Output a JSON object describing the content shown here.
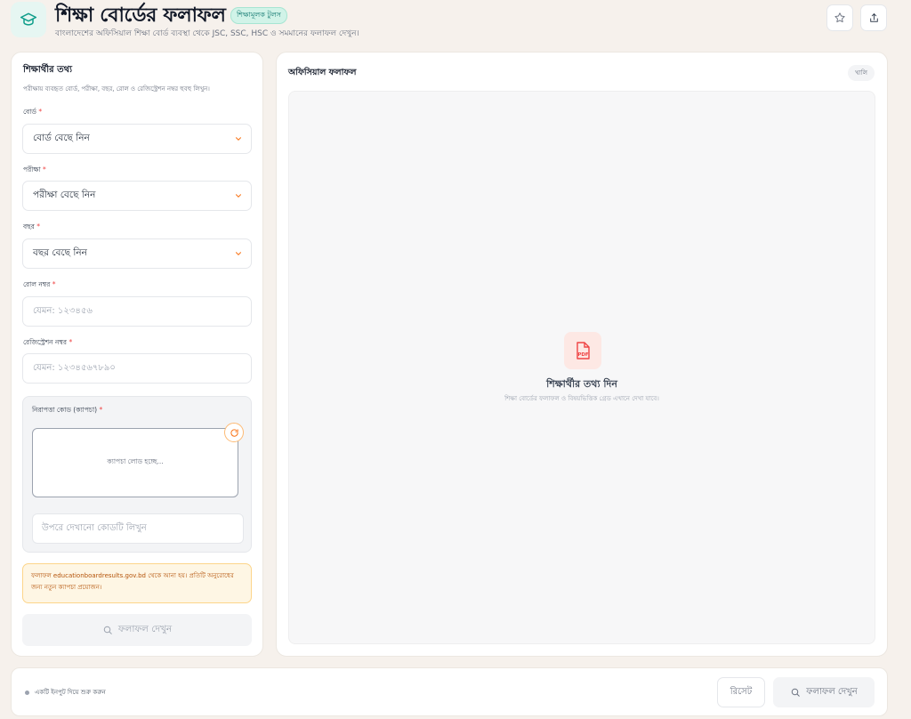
{
  "header": {
    "title": "শিক্ষা বোর্ডের ফলাফল",
    "badge": "শিক্ষামূলক টুলস",
    "subtitle": "বাংলাদেশের অফিসিয়াল শিক্ষা বোর্ড ব্যবস্থা থেকে JSC, SSC, HSC ও সমমানের ফলাফল দেখুন।",
    "logo_icon": "graduation-cap-icon",
    "favorite_icon": "star-icon",
    "share_icon": "share-icon"
  },
  "form": {
    "section_title": "শিক্ষার্থীর তথ্য",
    "section_desc": "পরীক্ষায় ব্যবহৃত বোর্ড, পরীক্ষা, বছর, রোল ও রেজিস্ট্রেশন নম্বর হুবহু লিখুন।",
    "required_mark": "*",
    "board": {
      "label": "বোর্ড",
      "value": "বোর্ড বেছে নিন"
    },
    "exam": {
      "label": "পরীক্ষা",
      "value": "পরীক্ষা বেছে নিন"
    },
    "year": {
      "label": "বছর",
      "value": "বছর বেছে নিন"
    },
    "roll": {
      "label": "রোল নম্বর",
      "placeholder": "যেমন: ১২৩৪৫৬"
    },
    "registration": {
      "label": "রেজিস্ট্রেশন নম্বর",
      "placeholder": "যেমন: ১২৩৪৫৬৭৮৯০"
    },
    "captcha": {
      "label": "নিরাপত্তা কোড (ক্যাপচা)",
      "loading_text": "ক্যাপচা লোড হচ্ছে...",
      "input_placeholder": "উপরে দেখানো কোডটি লিখুন"
    },
    "notice": "ফলাফল educationboardresults.gov.bd থেকে আনা হয়। প্রতিটি অনুরোধের জন্য নতুন ক্যাপচা প্রয়োজন।",
    "submit_label": "ফলাফল দেখুন"
  },
  "result_panel": {
    "title": "অফিসিয়াল ফলাফল",
    "status_badge": "খালি",
    "empty_title": "শিক্ষার্থীর তথ্য দিন",
    "empty_subtitle": "শিক্ষা বোর্ডের ফলাফল ও বিষয়ভিত্তিক গ্রেড এখানে দেখা যাবে।",
    "pdf_icon_text": "PDF"
  },
  "bottom_bar": {
    "status": "একটি ইনপুট দিয়ে শুরু করুন",
    "reset_label": "রিসেট",
    "submit_label": "ফলাফল দেখুন"
  },
  "colors": {
    "accent": "#0f766e",
    "background": "#f6f1ec",
    "warning": "#b45309",
    "required": "#ef4444"
  }
}
